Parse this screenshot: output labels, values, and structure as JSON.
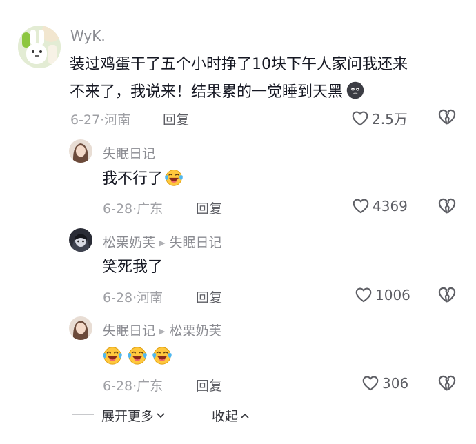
{
  "comment": {
    "username": "WyK.",
    "line1": "装过鸡蛋干了五个小时挣了10块下午人家问我还来",
    "line2": "不来了，我说来！结果累的一觉睡到天黑",
    "emoji": "sad-face-emoji",
    "date_location": "6-27·河南",
    "reply_label": "回复",
    "likes": "2.5万"
  },
  "replies": [
    {
      "username": "失眠日记",
      "reply_to": "",
      "text": "我不行了",
      "emoji": "laugh-cry-emoji",
      "date_location": "6-28·广东",
      "reply_label": "回复",
      "likes": "4369"
    },
    {
      "username": "松栗奶芙",
      "reply_to": "失眠日记",
      "text": "笑死我了",
      "date_location": "6-28·河南",
      "reply_label": "回复",
      "likes": "1006"
    },
    {
      "username": "失眠日记",
      "reply_to": "松栗奶芙",
      "text": "",
      "emoji": "laugh-cry-emoji",
      "emoji_count": 3,
      "date_location": "6-28·广东",
      "reply_label": "回复",
      "likes": "306"
    }
  ],
  "footer": {
    "expand_label": "展开更多",
    "collapse_label": "收起"
  }
}
